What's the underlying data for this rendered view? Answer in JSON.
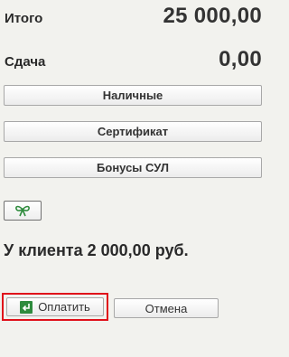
{
  "summary": {
    "total_label": "Итого",
    "total_value": "25 000,00",
    "change_label": "Сдача",
    "change_value": "0,00"
  },
  "payment_methods": [
    {
      "label": "Наличные"
    },
    {
      "label": "Сертификат"
    },
    {
      "label": "Бонусы СУЛ"
    }
  ],
  "gift_button": {
    "icon": "gift-bow-icon",
    "color": "#2e8b3d"
  },
  "client_message": "У клиента 2 000,00 руб.",
  "actions": {
    "pay_label": "Оплатить",
    "pay_icon": "enter-arrow-icon",
    "pay_highlight_color": "#e0101a",
    "cancel_label": "Отмена"
  }
}
